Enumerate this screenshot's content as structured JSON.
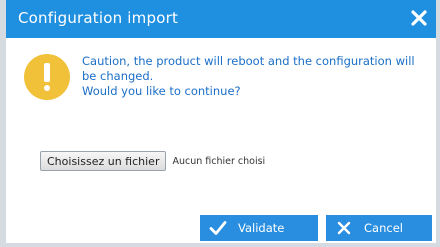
{
  "dialog": {
    "title": "Configuration import",
    "message_line1": "Caution, the product will reboot and the configuration will",
    "message_line2": "be changed.",
    "message_line3": "Would you like to continue?",
    "file_button_label": "Choisissez un fichier",
    "file_status": "Aucun fichier choisi",
    "validate_label": "Validate",
    "cancel_label": "Cancel"
  },
  "icons": {
    "close": "close-icon",
    "warning": "warning-icon",
    "validate": "check-icon",
    "cancel": "x-icon"
  },
  "colors": {
    "title_bar": "#1f8fe0",
    "message_text": "#1b6fc7",
    "warning": "#f1c13a",
    "buttons": "#2a8ee0"
  }
}
